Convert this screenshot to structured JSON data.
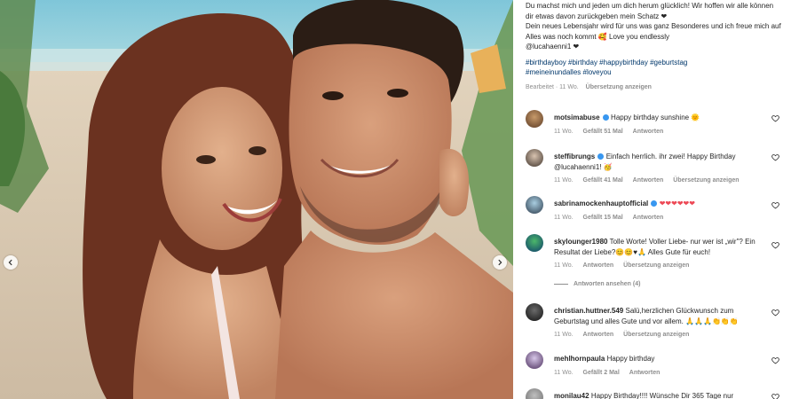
{
  "post": {
    "caption_lines": [
      "Du machst mich und jeden um dich herum glücklich! Wir hoffen wir alle können dir etwas davon zurückgeben mein Schatz ❤",
      "Dein neues Lebensjahr wird für uns was ganz Besonderes und ich freue mich auf Alles was noch kommt 🥰 Love you endlessly",
      "@lucahaenni1 ❤"
    ],
    "hashtags_line1": "#birthdayboy #birthday #happybirthday #geburtstag",
    "hashtags_line2": "#meineinundalles #loveyou",
    "edited": "Bearbeitet · 11 Wo.",
    "translate": "Übersetzung anzeigen"
  },
  "comments": [
    {
      "user": "motsimabuse",
      "verified": true,
      "text": "Happy birthday sunshine 🌞",
      "time": "11 Wo.",
      "likes": "Gefällt 51 Mal",
      "reply": "Antworten",
      "translate": ""
    },
    {
      "user": "steffibrungs",
      "verified": true,
      "text": "Einfach herrlich. ihr zwei! Happy Birthday @lucahaenni1! 🥳",
      "time": "11 Wo.",
      "likes": "Gefällt 41 Mal",
      "reply": "Antworten",
      "translate": "Übersetzung anzeigen"
    },
    {
      "user": "sabrinamockenhauptofficial",
      "verified": true,
      "text": "❤❤❤❤❤❤",
      "time": "11 Wo.",
      "likes": "Gefällt 15 Mal",
      "reply": "Antworten",
      "translate": ""
    },
    {
      "user": "skylounger1980",
      "verified": false,
      "text": "Tolle Worte! Voller Liebe- nur wer ist „wir\"? Ein Resultat der Liebe?😊😊♥🙏 Alles Gute für euch!",
      "time": "11 Wo.",
      "likes": "",
      "reply": "Antworten",
      "translate": "Übersetzung anzeigen"
    },
    {
      "user": "christian.huttner.549",
      "verified": false,
      "text": "Salü,herzlichen Glückwunsch zum Geburtstag und alles Gute und vor allem. 🙏🙏🙏👏👏👏",
      "time": "11 Wo.",
      "likes": "",
      "reply": "Antworten",
      "translate": "Übersetzung anzeigen"
    },
    {
      "user": "mehlhornpaula",
      "verified": false,
      "text": "Happy birthday",
      "time": "11 Wo.",
      "likes": "Gefällt 2 Mal",
      "reply": "Antworten",
      "translate": ""
    },
    {
      "user": "monilau42",
      "verified": false,
      "text": "Happy Birthday!!!! Wünsche Dir 365 Tage nur",
      "time": "",
      "likes": "",
      "reply": "",
      "translate": ""
    }
  ],
  "view_replies": "Antworten ansehen (4)",
  "icons": {
    "carousel_prev": "chevron-left-icon",
    "carousel_next": "chevron-right-icon",
    "like": "heart-icon",
    "verified": "verified-badge-icon"
  },
  "colors": {
    "link": "#00376b",
    "heart_red": "#ed4956",
    "meta_gray": "#8e8e8e",
    "verified_blue": "#3897f0"
  }
}
